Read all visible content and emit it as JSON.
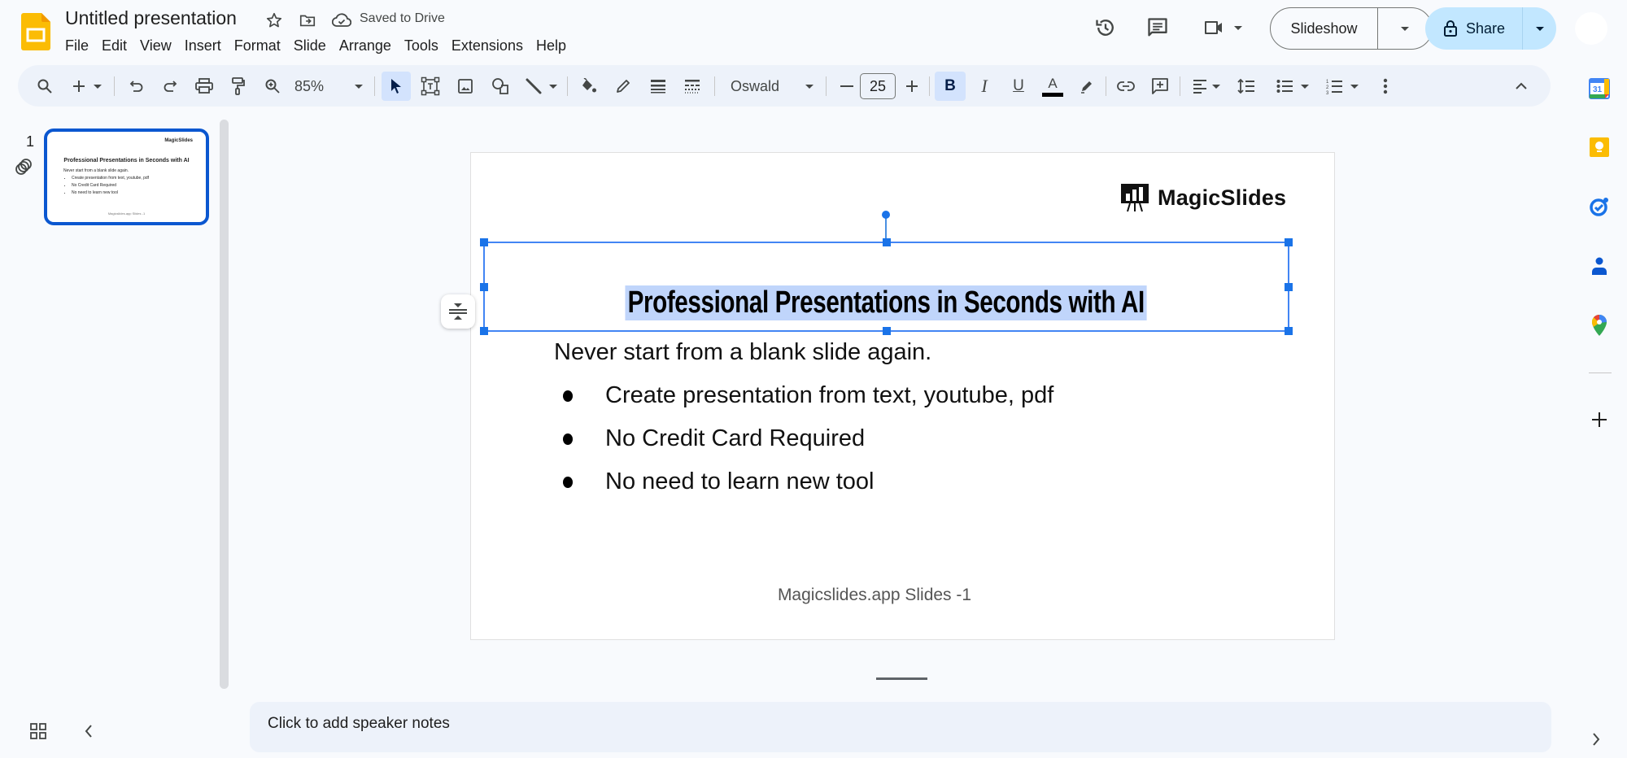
{
  "app": {
    "title": "Untitled presentation",
    "save_status": "Saved to Drive",
    "brand_color": "#fbbc04"
  },
  "menu": {
    "items": [
      "File",
      "Edit",
      "View",
      "Insert",
      "Format",
      "Slide",
      "Arrange",
      "Tools",
      "Extensions",
      "Help"
    ]
  },
  "header_actions": {
    "slideshow_label": "Slideshow",
    "share_label": "Share",
    "share_color": "#c2e7ff"
  },
  "toolbar": {
    "zoom": "85%",
    "font": "Oswald",
    "font_size": "25",
    "bold_active": true,
    "text_color": "#000000"
  },
  "filmstrip": {
    "slide_number": "1",
    "thumbnail": {
      "logo": "MagicSlides",
      "title": "Professional Presentations in Seconds with AI",
      "subtitle": "Never start from a blank slide again.",
      "bullets": [
        "Create presentation from text, youtube, pdf",
        "No Credit Card Required",
        "No need to learn new tool"
      ],
      "footer": "Magicslides.app Slides -1"
    }
  },
  "slide": {
    "logo_text": "MagicSlides",
    "title": "Professional Presentations in Seconds with AI",
    "subtitle": "Never start from a blank slide again.",
    "bullets": [
      "Create presentation from text, youtube, pdf",
      "No Credit Card Required",
      "No need to learn new tool"
    ],
    "footer": "Magicslides.app Slides -1",
    "selection_color": "#1a73e8"
  },
  "notes": {
    "placeholder": "Click to add speaker notes"
  },
  "side_panel": {
    "apps": [
      "calendar",
      "keep",
      "tasks",
      "contacts",
      "maps"
    ],
    "calendar_day": "31"
  }
}
